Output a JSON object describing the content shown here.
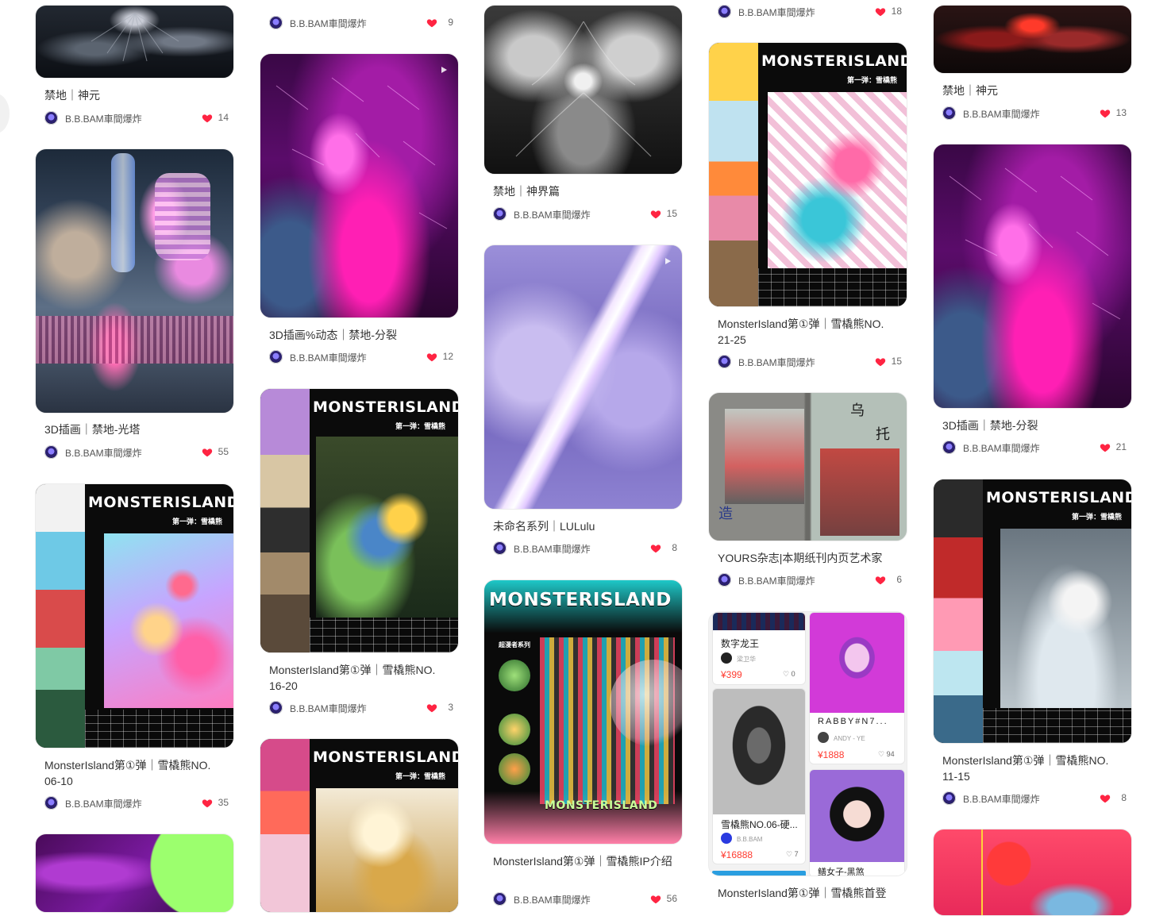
{
  "colors": {
    "heart": "#ff2442",
    "price": "#ff3b30",
    "text": "#333333",
    "author_text": "#555555"
  },
  "icons": {
    "like": "heart-icon",
    "avatar": "author-avatar",
    "video": "play-icon",
    "mini_like": "heart-outline-icon"
  },
  "cards": [
    {
      "title": "禁地｜神元",
      "author": "B.B.BAM車間爆炸",
      "likes": "14"
    },
    {
      "title": "3D插画｜禁地-光塔",
      "author": "B.B.BAM車間爆炸",
      "likes": "55"
    },
    {
      "title": "MonsterIsland第①弹｜雪橇熊NO. 06-10",
      "author": "B.B.BAM車間爆炸",
      "likes": "35",
      "overlay_title": "MONSTERISLAND",
      "overlay_sub": "第一弹：雪橇熊"
    },
    {
      "author": "B.B.BAM車間爆炸",
      "likes": "9"
    },
    {
      "title": "3D插画%动态｜禁地-分裂",
      "author": "B.B.BAM車間爆炸",
      "likes": "12"
    },
    {
      "title": "MonsterIsland第①弹｜雪橇熊NO. 16-20",
      "author": "B.B.BAM車間爆炸",
      "likes": "3",
      "overlay_title": "MONSTERISLAND",
      "overlay_sub": "第一弹：雪橇熊"
    },
    {
      "overlay_title": "MONSTERISLAND",
      "overlay_sub": "第一弹：雪橇熊"
    },
    {
      "title": "禁地｜神界篇",
      "author": "B.B.BAM車間爆炸",
      "likes": "15"
    },
    {
      "title": "未命名系列｜LULulu",
      "author": "B.B.BAM車間爆炸",
      "likes": "8"
    },
    {
      "title": "MonsterIsland第①弹｜雪橇熊IP介绍",
      "author": "B.B.BAM車間爆炸",
      "likes": "56",
      "overlay_title": "MONSTERISLAND",
      "overlay_bottom": "MONSTERISLAND",
      "overlay_side": "超漫者系列"
    },
    {
      "author": "B.B.BAM車間爆炸",
      "likes": "18"
    },
    {
      "title": "MonsterIsland第①弹｜雪橇熊NO. 21-25",
      "author": "B.B.BAM車間爆炸",
      "likes": "15",
      "overlay_title": "MONSTERISLAND",
      "overlay_sub": "第一弹：雪橇熊"
    },
    {
      "title": "YOURS杂志|本期纸刊内页艺术家",
      "author": "B.B.BAM車間爆炸",
      "likes": "6",
      "overlay_chars": [
        "造",
        "乌",
        "托"
      ]
    },
    {
      "title": "MonsterIsland第①弹｜雪橇熊首登"
    },
    {
      "title": "禁地｜神元",
      "author": "B.B.BAM車間爆炸",
      "likes": "13"
    },
    {
      "title": "3D插画｜禁地-分裂",
      "author": "B.B.BAM車間爆炸",
      "likes": "21"
    },
    {
      "title": "MonsterIsland第①弹｜雪橇熊NO. 11-15",
      "author": "B.B.BAM車間爆炸",
      "likes": "8",
      "overlay_title": "MONSTERISLAND",
      "overlay_sub": "第一弹：雪橇熊"
    }
  ],
  "collage": {
    "items": [
      {
        "title": "数字龙王",
        "author": "梁卫华",
        "price": "¥399",
        "likes": "0"
      },
      {
        "title": "RABBY#N7...",
        "author": "ANDY - YE",
        "price": "¥1888",
        "likes": "94"
      },
      {
        "title": "雪橇熊NO.06-硬...",
        "author": "B.B.BAM",
        "price": "¥16888",
        "likes": "7"
      },
      {
        "title": "鳝女子-黑煞"
      }
    ]
  }
}
